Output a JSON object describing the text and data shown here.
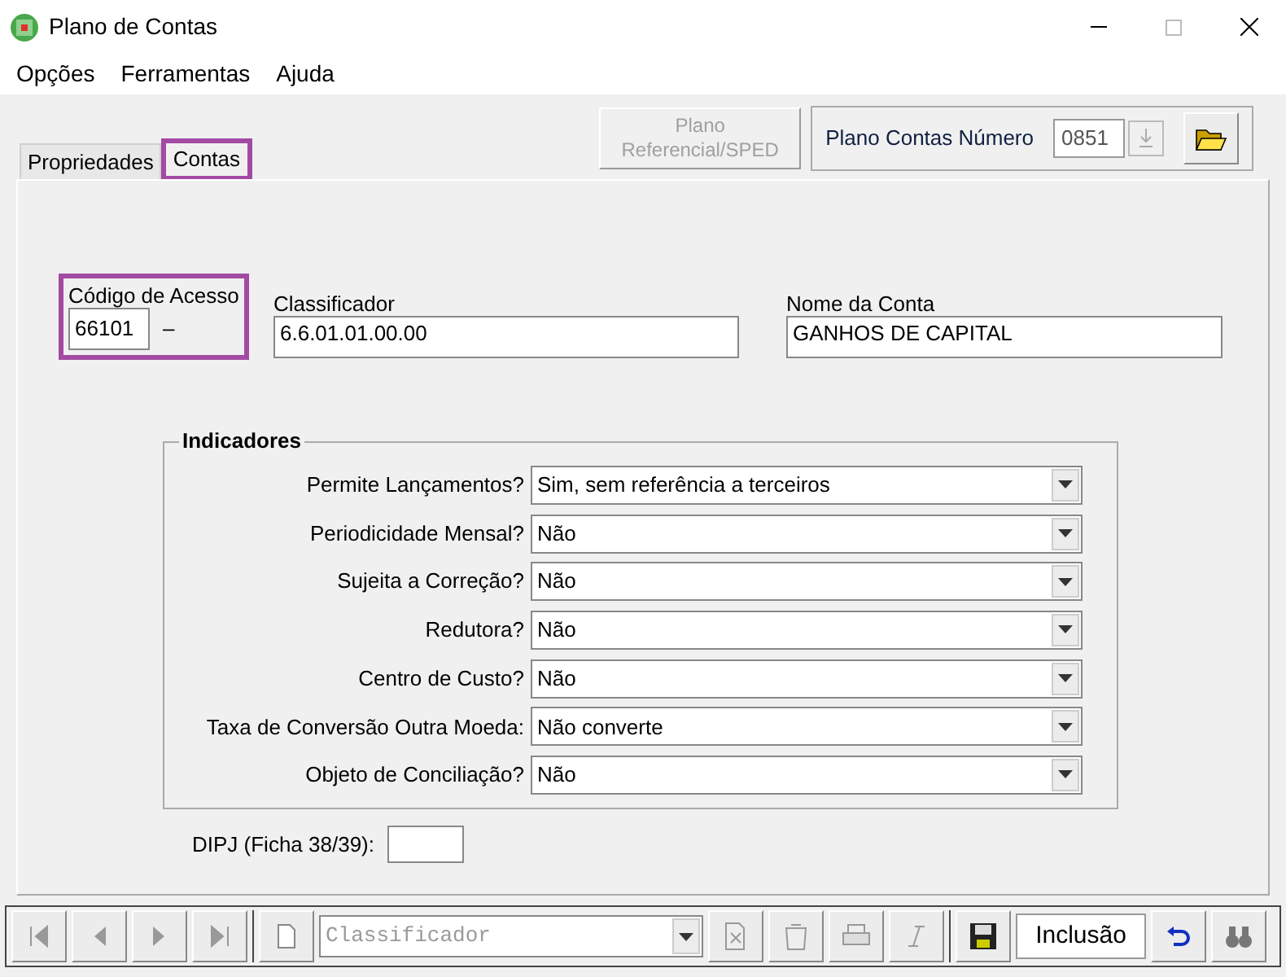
{
  "window": {
    "title": "Plano de Contas"
  },
  "menu": [
    "Opções",
    "Ferramentas",
    "Ajuda"
  ],
  "top": {
    "sped_button": {
      "label": "Plano Referencial/SPED",
      "disabled": true
    },
    "plan_label": "Plano Contas Número",
    "plan_number": "0851"
  },
  "tabs": [
    {
      "label": "Propriedades",
      "selected": false,
      "highlighted": false
    },
    {
      "label": "Contas",
      "selected": true,
      "highlighted": true
    }
  ],
  "account": {
    "code_label": "Código de Acesso",
    "code": "66101",
    "code_suffix": "–",
    "code_highlighted": true,
    "classifier_label": "Classificador",
    "classifier": "6.6.01.01.00.00",
    "name_label": "Nome da Conta",
    "name": "GANHOS DE CAPITAL"
  },
  "indicators": {
    "title": "Indicadores",
    "rows": [
      {
        "label": "Permite Lançamentos?",
        "value": "Sim, sem referência a terceiros"
      },
      {
        "label": "Periodicidade Mensal?",
        "value": "Não"
      },
      {
        "label": "Sujeita a Correção?",
        "value": "Não"
      },
      {
        "label": "Redutora?",
        "value": "Não"
      },
      {
        "label": "Centro de Custo?",
        "value": "Não"
      },
      {
        "label": "Taxa de Conversão Outra Moeda:",
        "value": "Não converte"
      },
      {
        "label": "Objeto de Conciliação?",
        "value": "Não"
      }
    ]
  },
  "dipj": {
    "label": "DIPJ (Ficha 38/39):"
  },
  "bottom": {
    "search_placeholder": "Classificador",
    "mode": "Inclusão"
  }
}
